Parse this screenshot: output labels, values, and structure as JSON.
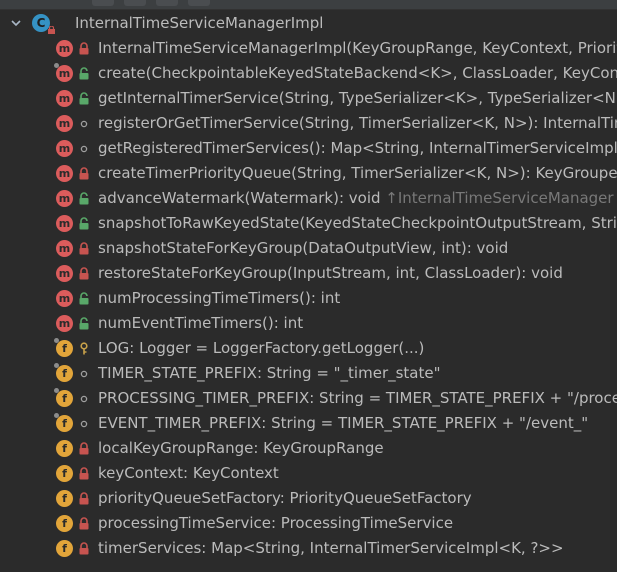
{
  "class_node": {
    "name": "InternalTimeServiceManagerImpl",
    "icon_letter": "C"
  },
  "members": [
    {
      "kind": "m",
      "visibility": "private",
      "text": "InternalTimeServiceManagerImpl(KeyGroupRange, KeyContext, Priority"
    },
    {
      "kind": "m",
      "visibility": "public-static",
      "text": "create(CheckpointableKeyedStateBackend<K>, ClassLoader, KeyContex"
    },
    {
      "kind": "m",
      "visibility": "public",
      "text": "getInternalTimerService(String, TypeSerializer<K>, TypeSerializer<N>, "
    },
    {
      "kind": "m",
      "visibility": "package",
      "text": "registerOrGetTimerService(String, TimerSerializer<K, N>): InternalTimer"
    },
    {
      "kind": "m",
      "visibility": "package",
      "text": "getRegisteredTimerServices(): Map<String, InternalTimerServiceImpl<K"
    },
    {
      "kind": "m",
      "visibility": "private",
      "text": "createTimerPriorityQueue(String, TimerSerializer<K, N>): KeyGroupedIn"
    },
    {
      "kind": "m",
      "visibility": "public",
      "text": "advanceWatermark(Watermark): void",
      "origin": "↑InternalTimeServiceManager"
    },
    {
      "kind": "m",
      "visibility": "public",
      "text": "snapshotToRawKeyedState(KeyedStateCheckpointOutputStream, String"
    },
    {
      "kind": "m",
      "visibility": "private",
      "text": "snapshotStateForKeyGroup(DataOutputView, int): void"
    },
    {
      "kind": "m",
      "visibility": "private",
      "text": "restoreStateForKeyGroup(InputStream, int, ClassLoader): void"
    },
    {
      "kind": "m",
      "visibility": "public",
      "text": "numProcessingTimeTimers(): int"
    },
    {
      "kind": "m",
      "visibility": "public",
      "text": "numEventTimeTimers(): int"
    },
    {
      "kind": "f",
      "visibility": "protected",
      "static": true,
      "text": "LOG: Logger = LoggerFactory.getLogger(...)"
    },
    {
      "kind": "f",
      "visibility": "package",
      "static": true,
      "text": "TIMER_STATE_PREFIX: String = \"_timer_state\""
    },
    {
      "kind": "f",
      "visibility": "package",
      "static": true,
      "text": "PROCESSING_TIMER_PREFIX: String = TIMER_STATE_PREFIX + \"/process"
    },
    {
      "kind": "f",
      "visibility": "package",
      "static": true,
      "text": "EVENT_TIMER_PREFIX: String = TIMER_STATE_PREFIX + \"/event_\""
    },
    {
      "kind": "f",
      "visibility": "private",
      "text": "localKeyGroupRange: KeyGroupRange"
    },
    {
      "kind": "f",
      "visibility": "private",
      "text": "keyContext: KeyContext"
    },
    {
      "kind": "f",
      "visibility": "private",
      "text": "priorityQueueSetFactory: PriorityQueueSetFactory"
    },
    {
      "kind": "f",
      "visibility": "private",
      "text": "processingTimeService: ProcessingTimeService"
    },
    {
      "kind": "f",
      "visibility": "private",
      "text": "timerServices: Map<String, InternalTimerServiceImpl<K, ?>>"
    }
  ],
  "colors": {
    "background": "#2b2b2b",
    "text": "#bbbbbb",
    "inherited_text": "#787878",
    "method_icon": "#db5c5c",
    "field_icon": "#e2a53a",
    "class_icon": "#3592c4",
    "private_lock": "#c75450",
    "public_unlock": "#59a869"
  }
}
